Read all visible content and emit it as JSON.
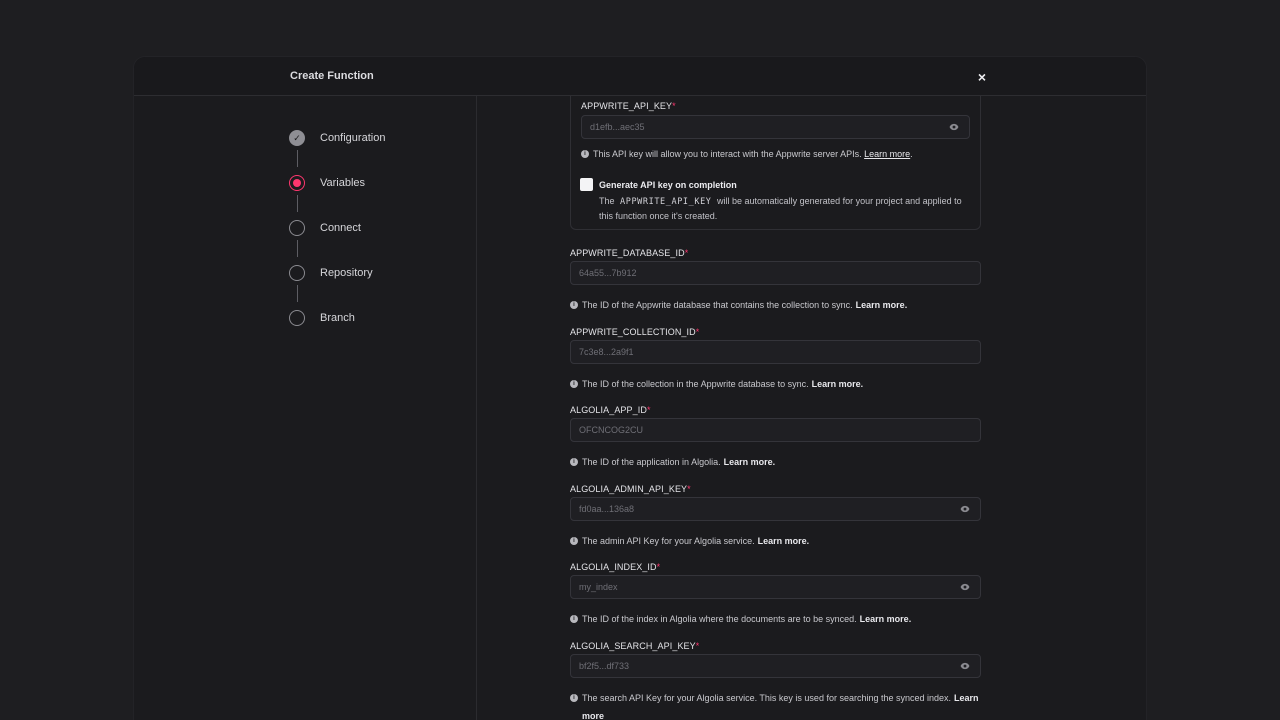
{
  "modal": {
    "title": "Create Function",
    "close": "×"
  },
  "steps": [
    {
      "label": "Configuration",
      "state": "done"
    },
    {
      "label": "Variables",
      "state": "active"
    },
    {
      "label": "Connect",
      "state": "pending"
    },
    {
      "label": "Repository",
      "state": "pending"
    },
    {
      "label": "Branch",
      "state": "pending"
    }
  ],
  "api_key": {
    "label": "APPWRITE_API_KEY",
    "value": "d1efb...aec35",
    "help": "This API key will allow you to interact with the Appwrite server APIs.",
    "link": "Learn more",
    "generate_label": "Generate API key on completion",
    "generate_desc_pre": "The",
    "generate_desc_code": "APPWRITE_API_KEY",
    "generate_desc_post": "will be automatically generated for your project and applied to this function once it's created."
  },
  "fields": [
    {
      "label": "APPWRITE_DATABASE_ID",
      "value": "64a55...7b912",
      "secret": false,
      "help": "The ID of the Appwrite database that contains the collection to sync.",
      "link": "Learn more."
    },
    {
      "label": "APPWRITE_COLLECTION_ID",
      "value": "7c3e8...2a9f1",
      "secret": false,
      "help": "The ID of the collection in the Appwrite database to sync.",
      "link": "Learn more."
    },
    {
      "label": "ALGOLIA_APP_ID",
      "value": "OFCNCOG2CU",
      "secret": false,
      "help": "The ID of the application in Algolia.",
      "link": "Learn more."
    },
    {
      "label": "ALGOLIA_ADMIN_API_KEY",
      "value": "fd0aa...136a8",
      "secret": true,
      "help": "The admin API Key for your Algolia service.",
      "link": "Learn more."
    },
    {
      "label": "ALGOLIA_INDEX_ID",
      "value": "my_index",
      "secret": true,
      "help": "The ID of the index in Algolia where the documents are to be synced.",
      "link": "Learn more."
    },
    {
      "label": "ALGOLIA_SEARCH_API_KEY",
      "value": "bf2f5...df733",
      "secret": true,
      "help": "The search API Key for your Algolia service. This key is used for searching the synced index.",
      "link": "Learn more"
    }
  ],
  "required_mark": "*",
  "colors": {
    "accent": "#fd366e",
    "background": "#1b1b1e"
  }
}
